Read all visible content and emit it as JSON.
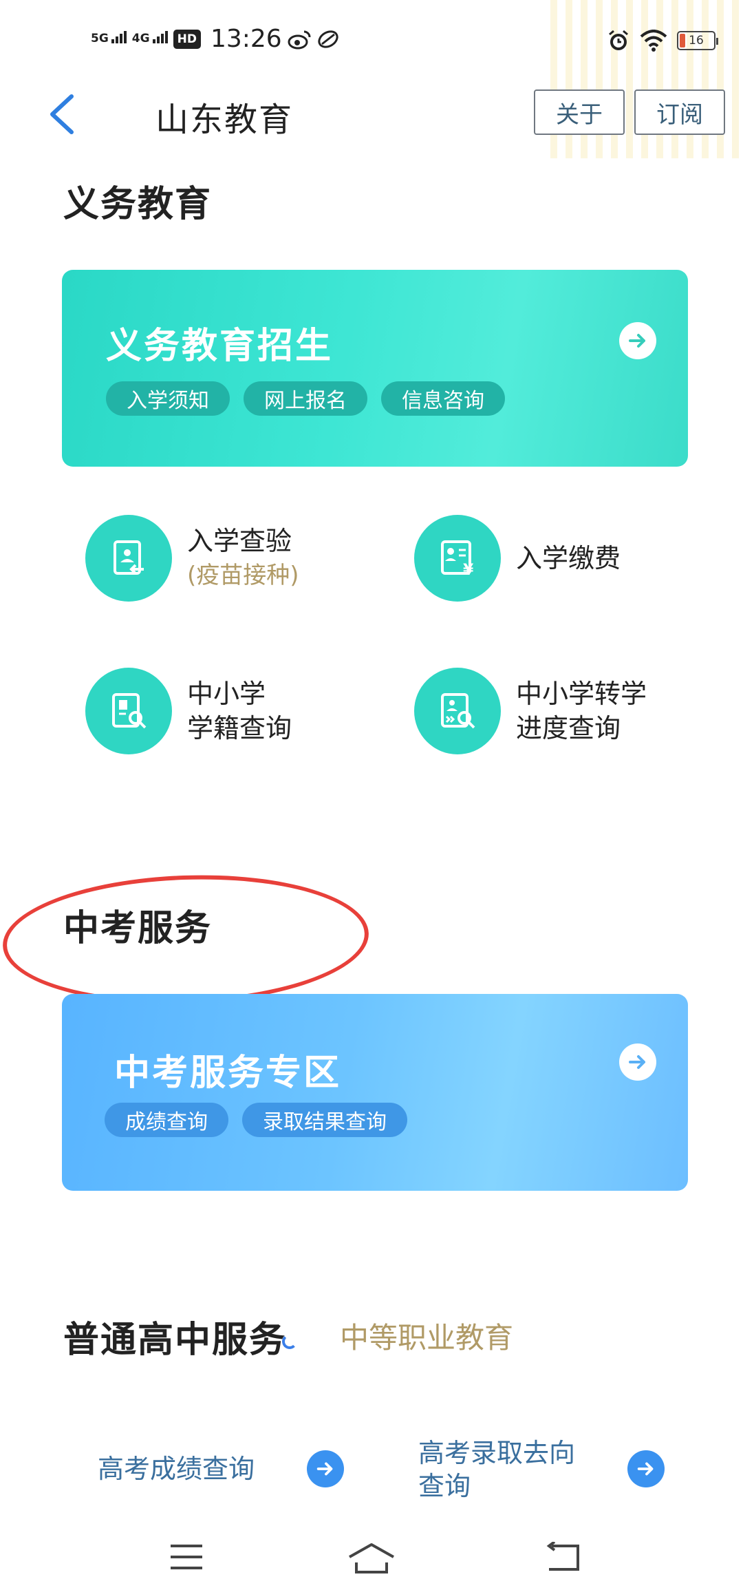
{
  "status_bar": {
    "network_1": "5G",
    "network_2": "4G",
    "hd": "HD",
    "time": "13:26",
    "battery": "16"
  },
  "header": {
    "title": "山东教育",
    "about_label": "关于",
    "subscribe_label": "订阅"
  },
  "compulsory": {
    "section_title": "义务教育",
    "banner": {
      "title": "义务教育招生",
      "chips": [
        "入学须知",
        "网上报名",
        "信息咨询"
      ]
    },
    "services": [
      {
        "line1": "入学查验",
        "line2": "(疫苗接种)"
      },
      {
        "line1": "入学缴费",
        "line2": ""
      },
      {
        "line1": "中小学",
        "line2": "学籍查询"
      },
      {
        "line1": "中小学转学",
        "line2": "进度查询"
      }
    ]
  },
  "zhongkao": {
    "section_title": "中考服务",
    "banner": {
      "title": "中考服务专区",
      "chips": [
        "成绩查询",
        "录取结果查询"
      ]
    }
  },
  "tabs": {
    "active": "普通高中服务",
    "inactive": "中等职业教育"
  },
  "gaokao_links": [
    {
      "label": "高考成绩查询"
    },
    {
      "label_line1": "高考录取去向",
      "label_line2": "查询"
    }
  ],
  "colors": {
    "green_accent": "#2fd6c3",
    "blue_accent": "#3a92f0",
    "annotation_red": "#e8403a"
  }
}
